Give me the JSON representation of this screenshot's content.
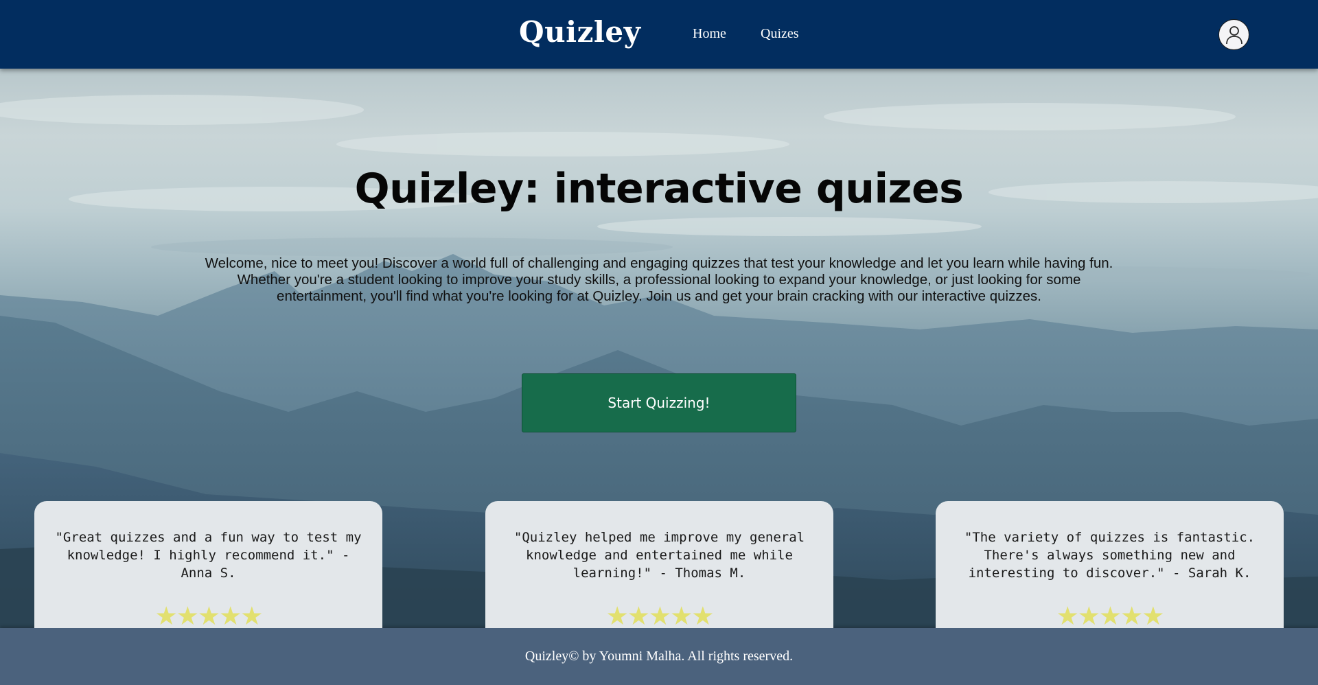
{
  "header": {
    "brand": "Quizley",
    "nav": [
      {
        "label": "Home"
      },
      {
        "label": "Quizes"
      }
    ],
    "avatar_icon": "user-avatar-icon"
  },
  "hero": {
    "title": "Quizley: interactive quizes",
    "intro": "Welcome, nice to meet you! Discover a world full of challenging and engaging quizzes that test your knowledge and let you learn while having fun. Whether you're a student looking to improve your study skills, a professional looking to expand your knowledge, or just looking for some entertainment, you'll find what you're looking for at Quizley. Join us and get your brain cracking with our interactive quizzes.",
    "cta_label": "Start Quizzing!"
  },
  "testimonials": [
    {
      "quote": "\"Great quizzes and a fun way to test my knowledge! I highly recommend it.\" - Anna S.",
      "stars": "★★★★★",
      "rating": 5
    },
    {
      "quote": "\"Quizley helped me improve my general knowledge and entertained me while learning!\" - Thomas M.",
      "stars": "★★★★★",
      "rating": 5
    },
    {
      "quote": "\"The variety of quizzes is fantastic. There's always something new and interesting to discover.\" - Sarah K.",
      "stars": "★★★★★",
      "rating": 5
    }
  ],
  "footer": {
    "text": "Quizley© by Youmni Malha. All rights reserved."
  },
  "colors": {
    "header_bg": "#022d5f",
    "cta_bg": "#176c4b",
    "card_bg": "#e3e7ea",
    "star": "#e2e06f",
    "footer_bg": "#4b627d"
  }
}
